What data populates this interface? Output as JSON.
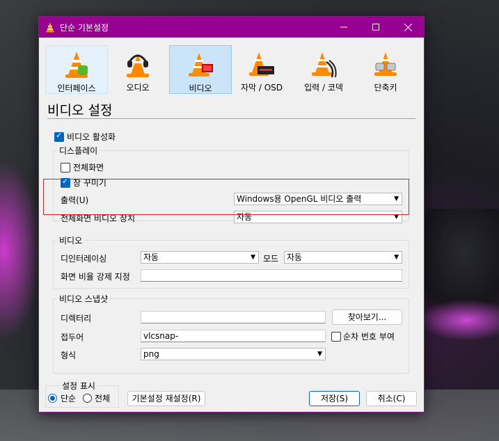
{
  "window": {
    "title": "단순 기본설정",
    "accent": "#970090"
  },
  "categories": [
    {
      "label": "인터페이스",
      "icon": "interface-cone-icon"
    },
    {
      "label": "오디오",
      "icon": "audio-headphone-cone-icon"
    },
    {
      "label": "비디오",
      "icon": "video-cone-icon"
    },
    {
      "label": "자막 / OSD",
      "icon": "subtitle-osd-cone-icon"
    },
    {
      "label": "입력 / 코덱",
      "icon": "input-codec-cone-icon"
    },
    {
      "label": "단축키",
      "icon": "hotkeys-cone-icon"
    }
  ],
  "section_title": "비디오 설정",
  "enable_video": {
    "label": "비디오 활성화",
    "checked": true
  },
  "display": {
    "title": "디스플레이",
    "fullscreen": {
      "label": "전체화면",
      "checked": false
    },
    "decorations": {
      "label": "창 꾸미기",
      "checked": true
    },
    "output_label": "출력(U)",
    "output_value": "Windows용 OpenGL 비디오 출력",
    "fs_device_label": "전체화면 비디오 장치",
    "fs_device_value": "자동"
  },
  "video": {
    "title": "비디오",
    "deinterlace_label": "디인터레이싱",
    "deinterlace_value": "자동",
    "mode_label": "모드",
    "mode_value": "자동",
    "aspect_label": "화면 비율 강제 지정",
    "aspect_value": ""
  },
  "snapshot": {
    "title": "비디오 스냅샷",
    "dir_label": "디렉터리",
    "dir_value": "",
    "browse_label": "찾아보기...",
    "prefix_label": "접두어",
    "prefix_value": "vlcsnap-",
    "sequential_label": "순차 번호 부여",
    "sequential_checked": false,
    "format_label": "형식",
    "format_value": "png"
  },
  "show_settings": {
    "title": "설정 표시",
    "simple_label": "단순",
    "all_label": "전체",
    "selected": "단순"
  },
  "buttons": {
    "reset": "기본설정 재설정(R)",
    "save": "저장(S)",
    "cancel": "취소(C)"
  }
}
